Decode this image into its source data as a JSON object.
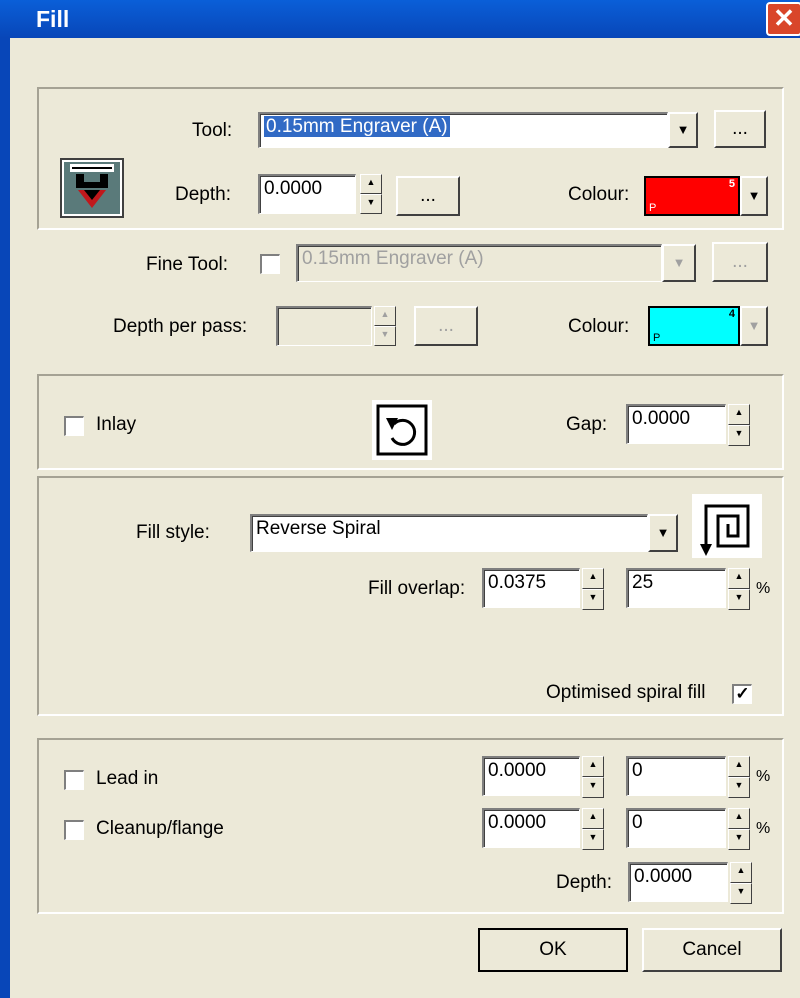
{
  "window": {
    "title": "Fill",
    "close_glyph": "✕"
  },
  "tool_section": {
    "tool_label": "Tool:",
    "tool_value": "0.15mm Engraver (A)",
    "tool_more": "...",
    "depth_label": "Depth:",
    "depth_value": "0.0000",
    "depth_more": "...",
    "colour_label": "Colour:",
    "colour": {
      "hex": "#ff0000",
      "number": "5",
      "marker": "P"
    }
  },
  "fine_tool": {
    "label": "Fine Tool:",
    "checked": false,
    "tool_value": "0.15mm Engraver (A)",
    "tool_more": "...",
    "depth_per_pass_label": "Depth per pass:",
    "depth_value": "",
    "depth_more": "...",
    "colour_label": "Colour:",
    "colour": {
      "hex": "#00ffff",
      "number": "4",
      "marker": "P"
    }
  },
  "inlay": {
    "label": "Inlay",
    "checked": false,
    "icon": "rotate-ccw-icon",
    "gap_label": "Gap:",
    "gap_value": "0.0000"
  },
  "fill": {
    "style_label": "Fill style:",
    "style_value": "Reverse Spiral",
    "icon": "reverse-spiral-icon",
    "overlap_label": "Fill overlap:",
    "overlap_value": "0.0375",
    "overlap_percent": "25",
    "percent_sign": "%",
    "optimised_label": "Optimised spiral fill",
    "optimised_checked": true
  },
  "lead": {
    "lead_in_label": "Lead in",
    "lead_in_checked": false,
    "lead_in_value": "0.0000",
    "lead_in_percent": "0",
    "cleanup_label": "Cleanup/flange",
    "cleanup_checked": false,
    "cleanup_value": "0.0000",
    "cleanup_percent": "0",
    "percent_sign": "%",
    "depth_label": "Depth:",
    "depth_value": "0.0000"
  },
  "buttons": {
    "ok": "OK",
    "cancel": "Cancel"
  }
}
